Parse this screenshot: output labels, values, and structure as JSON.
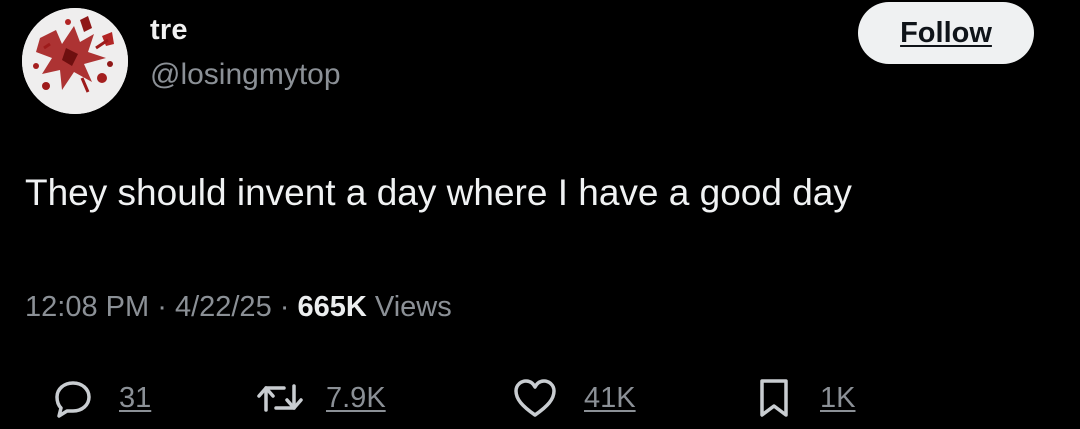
{
  "author": {
    "display_name": "tre",
    "handle": "@losingmytop",
    "avatar_icon": "splatter-avatar-icon"
  },
  "follow_label": "Follow",
  "tweet": {
    "text": "They should invent a day where I have a good day",
    "time": "12:08 PM",
    "date": "4/22/25",
    "separator": "·",
    "views_count": "665K",
    "views_label": "Views"
  },
  "actions": {
    "reply": {
      "icon": "reply-icon",
      "count": "31"
    },
    "repost": {
      "icon": "repost-icon",
      "count": "7.9K"
    },
    "like": {
      "icon": "heart-icon",
      "count": "41K"
    },
    "bookmark": {
      "icon": "bookmark-icon",
      "count": "1K"
    }
  },
  "colors": {
    "background": "#000000",
    "primary_text": "#e7e9ea",
    "secondary_text": "#8b9096",
    "button_bg": "#eff1f2",
    "avatar_splatter": "#9e1b1b"
  }
}
